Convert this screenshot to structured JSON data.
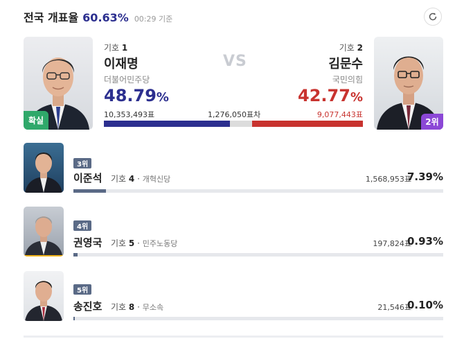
{
  "header": {
    "title": "전국 개표율",
    "pct": "60.63",
    "pct_sign": "%",
    "time": "00:29 기준",
    "refresh_icon": "refresh-icon"
  },
  "leaders": {
    "vs_label": "VS",
    "diff_label": "1,276,050표차",
    "candidate1": {
      "symbol_label": "기호",
      "symbol_no": "1",
      "name": "이재명",
      "party": "더불어민주당",
      "pct": "48.79",
      "pct_sign": "%",
      "votes": "10,353,493표",
      "status_badge": "확실",
      "color": "#2c2f8f",
      "share": 48.79
    },
    "candidate2": {
      "symbol_label": "기호",
      "symbol_no": "2",
      "name": "김문수",
      "party": "국민의힘",
      "pct": "42.77",
      "pct_sign": "%",
      "votes": "9,077,443표",
      "rank_badge": "2위",
      "color": "#c8332f",
      "share": 42.77
    }
  },
  "others": [
    {
      "rank": "3위",
      "name": "이준석",
      "symbol_label": "기호",
      "symbol_no": "4",
      "party": "개혁신당",
      "votes": "1,568,953표",
      "pct": "7.39%",
      "share": 7.39
    },
    {
      "rank": "4위",
      "name": "권영국",
      "symbol_label": "기호",
      "symbol_no": "5",
      "party": "민주노동당",
      "votes": "197,824표",
      "pct": "0.93%",
      "share": 0.93
    },
    {
      "rank": "5위",
      "name": "송진호",
      "symbol_label": "기호",
      "symbol_no": "8",
      "party": "무소속",
      "votes": "21,546표",
      "pct": "0.10%",
      "share": 0.1
    }
  ]
}
